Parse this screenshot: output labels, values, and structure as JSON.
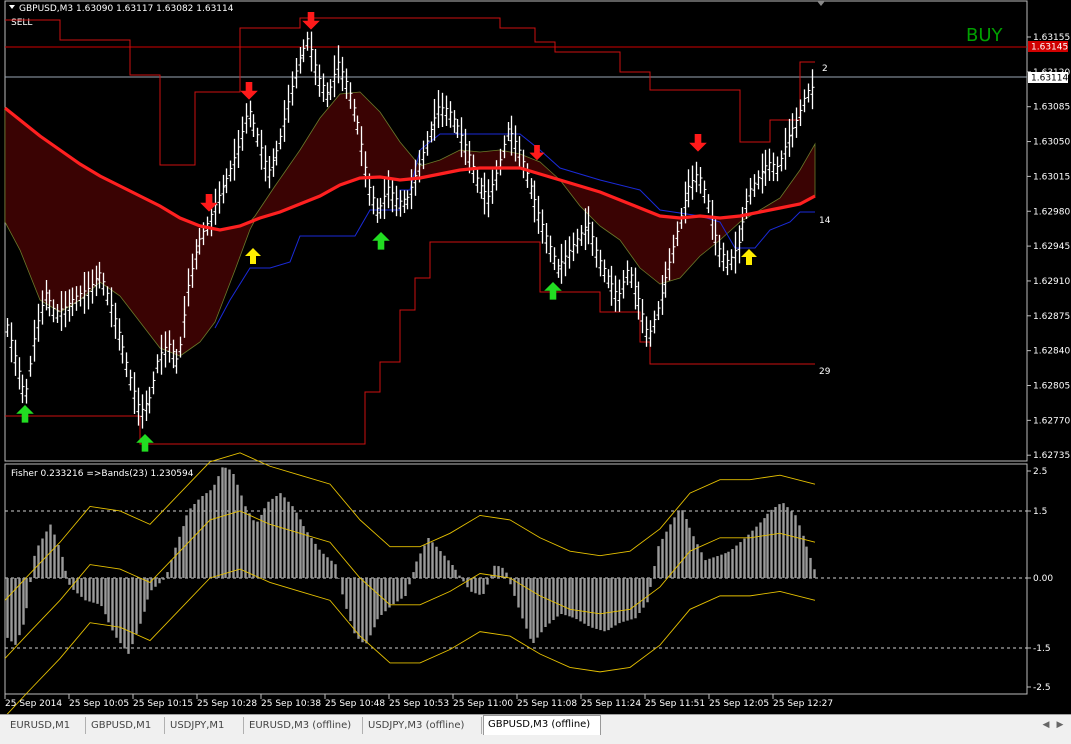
{
  "main_chart": {
    "header": "GBPUSD,M3  1.63090 1.63117 1.63082 1.63114",
    "sell_label": "SELL",
    "signal_label": "BUY",
    "signal_color": "#00a000",
    "price_labels": [
      "1.63155",
      "1.63120",
      "1.63085",
      "1.63050",
      "1.63015",
      "1.62980",
      "1.62945",
      "1.62910",
      "1.62875",
      "1.62840",
      "1.62805",
      "1.62770",
      "1.62735"
    ],
    "ask_line_value": "1.63145",
    "ask_line_color": "#d00000",
    "bid_line_value": "1.63114",
    "level_labels": [
      "2",
      "14",
      "29"
    ]
  },
  "indicator": {
    "header": "Fisher 0.233216  =>Bands(23) 1.230594",
    "levels": [
      "2.5",
      "1.5",
      "0.00",
      "-1.5",
      "-2.5"
    ]
  },
  "time_axis": [
    "25 Sep 2014",
    "25 Sep 10:05",
    "25 Sep 10:15",
    "25 Sep 10:28",
    "25 Sep 10:38",
    "25 Sep 10:48",
    "25 Sep 10:53",
    "25 Sep 11:00",
    "25 Sep 11:08",
    "25 Sep 11:24",
    "25 Sep 11:51",
    "25 Sep 12:05",
    "25 Sep 12:27"
  ],
  "tabs": [
    "EURUSD,M1",
    "GBPUSD,M1",
    "USDJPY,M1",
    "EURUSD,M3 (offline)",
    "USDJPY,M3 (offline)",
    "GBPUSD,M3 (offline)"
  ],
  "active_tab": "GBPUSD,M3 (offline)",
  "colors": {
    "background": "#000000",
    "bars": "#ffffff",
    "ma": "#ff2020",
    "cloud": "#3a0303",
    "channel_red": "#cc1111",
    "channel_blue": "#1a2ad8",
    "arrow_sell": "#ff1a1a",
    "arrow_buy": "#22dd22",
    "arrow_buy_weak": "#ffee00",
    "fisher_hist": "#9a9a9a",
    "fisher_bands": "#e5c000"
  },
  "icons": {
    "sell_signal": "arrow-down-icon",
    "buy_signal": "arrow-up-icon"
  }
}
